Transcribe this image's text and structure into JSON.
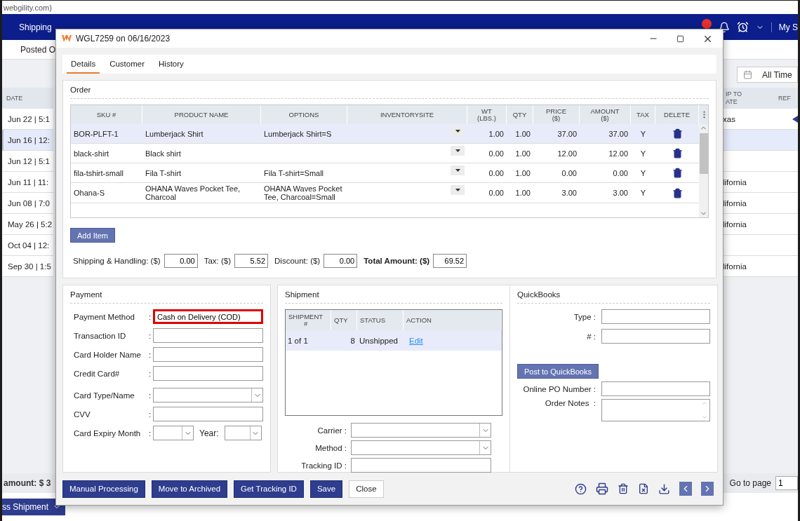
{
  "browser": {
    "address_fragment": "webgility.com)"
  },
  "nav": {
    "items": [
      "Shipping"
    ],
    "account": "My S"
  },
  "subbar": {
    "tab": "Posted O"
  },
  "date_filter": "All Time",
  "orders": {
    "columns": [
      "DATE",
      "IP TO\nATE",
      "REF"
    ],
    "rows": [
      {
        "date": "Jun 22 | 5:1",
        "state": "xas",
        "ref_marker": true,
        "selected": false
      },
      {
        "date": "Jun 16 | 12:",
        "ref_marker": false,
        "selected": true
      },
      {
        "date": "Jun 12 | 5:1",
        "ref_marker": false,
        "selected": false
      },
      {
        "date": "Jun 11 | 11:",
        "state": "lifornia",
        "ref_marker": false,
        "selected": false
      },
      {
        "date": "Jun 08 | 7:0",
        "state": "lifornia",
        "ref_marker": false,
        "selected": false
      },
      {
        "date": "May 26 | 5:2",
        "state": "lifornia",
        "ref_marker": false,
        "selected": false
      },
      {
        "date": "Oct 04 | 12:",
        "ref_marker": false,
        "selected": false
      },
      {
        "date": "Sep 30 | 1:5",
        "state": "lifornia",
        "ref_marker": false,
        "selected": false
      }
    ]
  },
  "summary": "amount: $ 3",
  "pager": {
    "label": "Go to page",
    "value": "1"
  },
  "process_button": "ss Shipment",
  "modal": {
    "title": "WGL7259 on 06/16/2023",
    "tabs": [
      {
        "label": "Details",
        "selected": true
      },
      {
        "label": "Customer",
        "selected": false
      },
      {
        "label": "History",
        "selected": false
      }
    ],
    "order": {
      "title": "Order",
      "columns": [
        "SKU #",
        "PRODUCT NAME",
        "OPTIONS",
        "INVENTORYSITE",
        "WT\n(LBS.)",
        "QTY",
        "PRICE\n($)",
        "AMOUNT\n($)",
        "TAX",
        "DELETE"
      ],
      "rows": [
        {
          "sku": "BOR-PLFT-1",
          "product": "Lumberjack Shirt",
          "options": "Lumberjack Shirt=S",
          "wt": "1.00",
          "qty": "1.00",
          "price": "37.00",
          "amount": "37.00",
          "tax": "Y",
          "selected": true
        },
        {
          "sku": "black-shirt",
          "product": "Black shirt",
          "wt": "0.00",
          "qty": "1.00",
          "price": "12.00",
          "amount": "12.00",
          "tax": "Y",
          "selected": false
        },
        {
          "sku": "fila-tshirt-small",
          "product": "Fila T-shirt",
          "options": "Fila T-shirt=Small",
          "wt": "0.00",
          "qty": "1.00",
          "price": "0.00",
          "amount": "0.00",
          "tax": "Y",
          "selected": false
        },
        {
          "sku": "Ohana-S",
          "product": "OHANA Waves Pocket Tee, Charcoal",
          "options": "OHANA Waves Pocket Tee, Charcoal=Small",
          "wt": "0.00",
          "qty": "1.00",
          "price": "3.00",
          "amount": "3.00",
          "tax": "Y",
          "selected": false
        }
      ],
      "add_item": "Add Item",
      "totals": [
        {
          "label": "Shipping & Handling: ($)",
          "value": "0.00",
          "bold": false
        },
        {
          "label": "Tax: ($)",
          "value": "5.52",
          "bold": false
        },
        {
          "label": "Discount: ($)",
          "value": "0.00",
          "bold": false
        },
        {
          "label": "Total Amount: ($)",
          "value": "69.52",
          "bold": true
        }
      ]
    },
    "payment": {
      "title": "Payment",
      "fields": [
        {
          "label": "Payment Method",
          "colon": ":",
          "kind": "text",
          "value": "Cash on Delivery (COD)",
          "highlighted": true
        },
        {
          "label": "Transaction ID",
          "colon": ":",
          "kind": "text",
          "highlighted": false
        },
        {
          "label": "Card Holder Name",
          "colon": ":",
          "kind": "text",
          "highlighted": false
        },
        {
          "label": "Credit Card#",
          "colon": ":",
          "kind": "text",
          "highlighted": false
        },
        {
          "label": "Card Type/Name",
          "colon": ":",
          "kind": "select"
        },
        {
          "label": "CVV",
          "colon": ":",
          "kind": "text",
          "highlighted": false
        },
        {
          "label": "Card Expiry Month",
          "colon": ":",
          "kind": "expiry",
          "second_label": "Year:"
        }
      ]
    },
    "shipment": {
      "title": "Shipment",
      "columns": [
        "SHIPMENT\n#",
        "QTY",
        "STATUS",
        "ACTION"
      ],
      "rows": [
        {
          "number": "1 of 1",
          "qty": "8",
          "status": "Unshipped",
          "action": "Edit",
          "selected": true
        }
      ],
      "fields": [
        {
          "label": "Carrier :",
          "kind": "select"
        },
        {
          "label": "Method :",
          "kind": "select"
        },
        {
          "label": "Tracking ID :",
          "kind": "text"
        }
      ]
    },
    "quickbooks": {
      "title": "QuickBooks",
      "fields": [
        {
          "label": "Type :",
          "kind": "text"
        },
        {
          "label": "# :",
          "kind": "text"
        }
      ],
      "button": "Post to QuickBooks",
      "more_fields": [
        {
          "label": "Online PO Number :",
          "kind": "text"
        },
        {
          "label": "Order Notes  :",
          "kind": "textarea"
        }
      ]
    },
    "footer_buttons": [
      {
        "label": "Manual Processing",
        "kind": "primary"
      },
      {
        "label": "Move to Archived",
        "kind": "primary"
      },
      {
        "label": "Get Tracking ID",
        "kind": "primary"
      },
      {
        "label": "Save",
        "kind": "primary"
      },
      {
        "label": "Close",
        "kind": "secondary"
      }
    ]
  }
}
